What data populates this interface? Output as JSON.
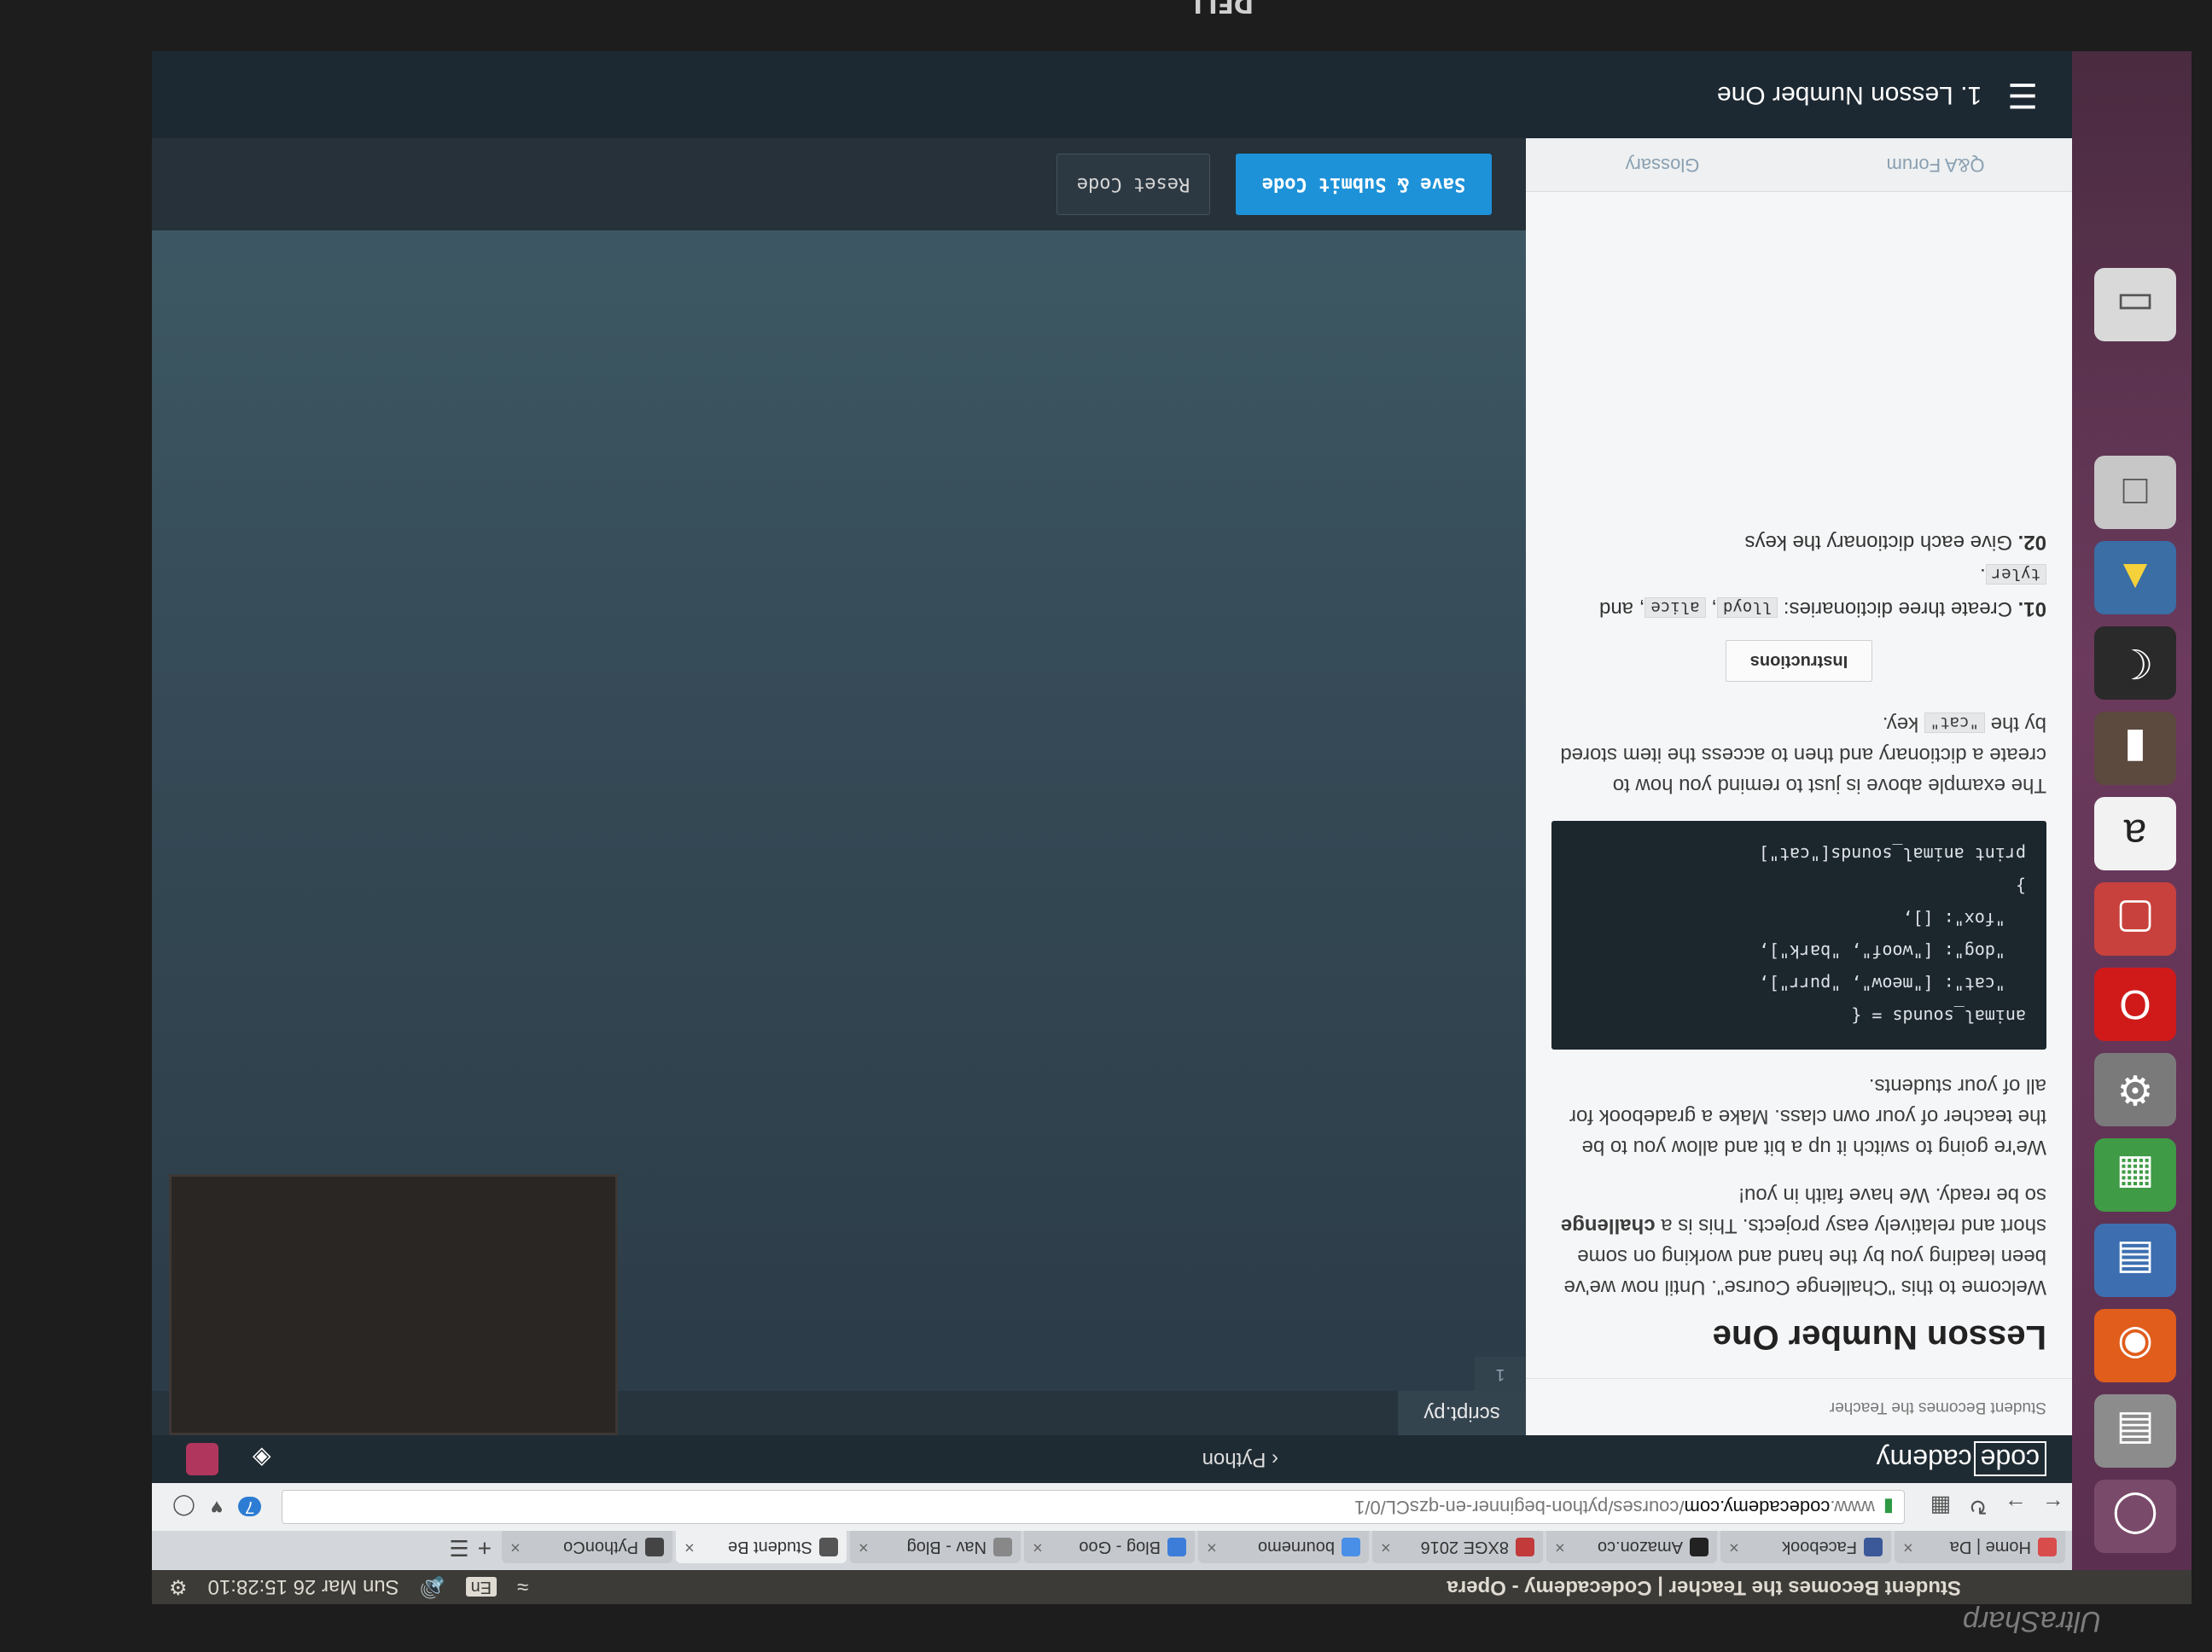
{
  "monitor": {
    "logo": "DELL",
    "brand": "UltraSharp"
  },
  "ubuntu_panel": {
    "window_title": "Student Becomes the Teacher | Codecademy - Opera",
    "lang": "En",
    "clock": "Sun Mar 26 15:28:10"
  },
  "tabs": [
    {
      "label": "Home | Da",
      "color": "#d94c4c"
    },
    {
      "label": "Facebook",
      "color": "#3b5998"
    },
    {
      "label": "Amazon.co",
      "color": "#222222"
    },
    {
      "label": "8XGE 2016",
      "color": "#c23a3a"
    },
    {
      "label": "bournemo",
      "color": "#4a8fe7"
    },
    {
      "label": "Blog - Goo",
      "color": "#3c7dd9"
    },
    {
      "label": "Nav - Blog",
      "color": "#888888"
    },
    {
      "label": "Student Be",
      "color": "#555555"
    },
    {
      "label": "PythonCo",
      "color": "#444444"
    }
  ],
  "address": {
    "prefix": "www.",
    "host": "codecademy.com",
    "path": "/courses/python-beginner-en-qzsCL/0/1",
    "badge": "7"
  },
  "codecademy": {
    "logo_box": "code",
    "logo_rest": "cademy",
    "course": "Python",
    "breadcrumb": "Student Becomes the Teacher",
    "file_tab": "script.py",
    "line_number": "1",
    "submit_label": "Save & Submit Code",
    "reset_label": "Reset Code",
    "nav_title": "1. Lesson Number One"
  },
  "lesson": {
    "title": "Lesson Number One",
    "p1": "Welcome to this \"Challenge Course\". Until now we've been leading you by the hand and working on some short and relatively easy projects. This is a",
    "p1_bold": "challenge",
    "p1_end": "so be ready. We have faith in you!",
    "p2": "We're going to switch it up a bit and allow you to be the teacher of your own class. Make a gradebook for all of your students.",
    "code_lines": [
      "animal_sounds = {",
      "  \"cat\": [\"meow\", \"purr\"],",
      "  \"dog\": [\"woof\", \"bark\"],",
      "  \"fox\": [],",
      "}",
      "print animal_sounds[\"cat\"]"
    ],
    "p3": "The example above is just to remind you how to create a dictionary and then to access the item stored by the",
    "p3_code": "\"cat\"",
    "p3_end": "key.",
    "instructions_tab": "Instructions",
    "step1_num": "01.",
    "step1_text": "Create three dictionaries:",
    "step1_c1": "lloyd",
    "step1_c2": "alice",
    "step1_and": ", and",
    "step1_c3": "tyler",
    "step2_num": "02.",
    "step2_text": "Give each dictionary the keys",
    "footer_qa": "Q&A Forum",
    "footer_glossary": "Glossary"
  }
}
